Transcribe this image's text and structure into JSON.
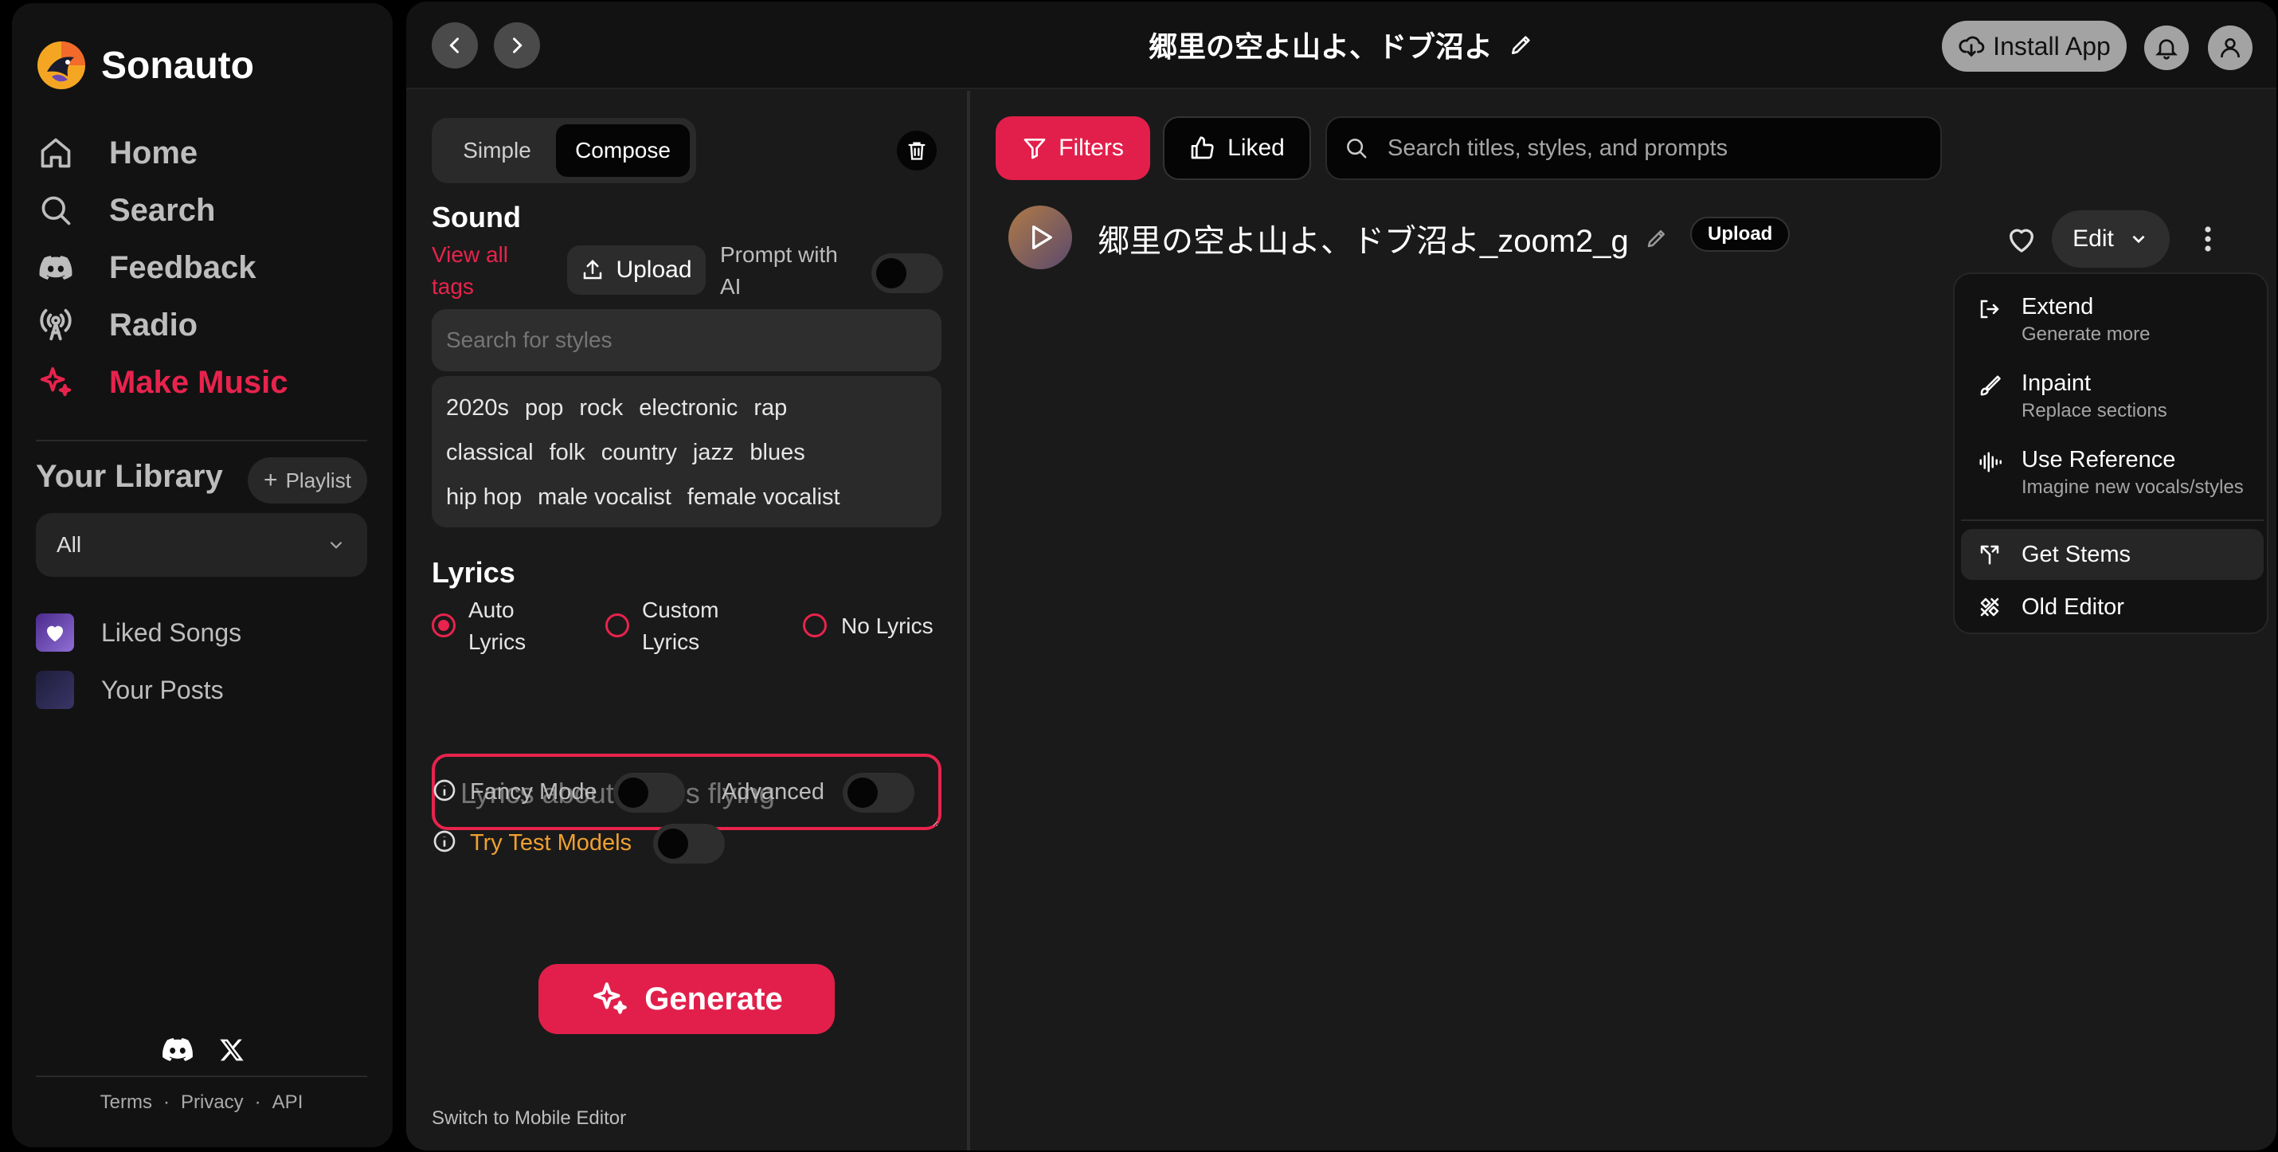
{
  "app": {
    "name": "Sonauto"
  },
  "sidebar": {
    "nav": [
      {
        "label": "Home",
        "icon": "home-icon"
      },
      {
        "label": "Search",
        "icon": "search-icon"
      },
      {
        "label": "Feedback",
        "icon": "discord-icon"
      },
      {
        "label": "Radio",
        "icon": "radio-icon"
      },
      {
        "label": "Make Music",
        "icon": "sparkle-icon",
        "active": true
      }
    ],
    "library_title": "Your Library",
    "playlist_label": "Playlist",
    "filter_value": "All",
    "library_items": [
      {
        "label": "Liked Songs",
        "icon": "heart-icon"
      },
      {
        "label": "Your Posts",
        "icon": "posts-thumb"
      }
    ],
    "footer": {
      "terms": "Terms",
      "privacy": "Privacy",
      "api": "API",
      "separator": "·"
    }
  },
  "topbar": {
    "title": "郷里の空よ山よ、ドブ沼よ",
    "install_label": "Install App"
  },
  "composer": {
    "mode_tabs": [
      "Simple",
      "Compose"
    ],
    "selected_mode": "Compose",
    "sound_heading": "Sound",
    "view_all_tags": "View all tags",
    "upload_label": "Upload",
    "prompt_with_ai": "Prompt with AI",
    "style_search_placeholder": "Search for styles",
    "tags": [
      [
        "2020s",
        "pop",
        "rock",
        "electronic",
        "rap"
      ],
      [
        "classical",
        "folk",
        "country",
        "jazz",
        "blues"
      ],
      [
        "hip hop",
        "male vocalist",
        "female vocalist"
      ]
    ],
    "lyrics_heading": "Lyrics",
    "lyrics_options": [
      "Auto Lyrics",
      "Custom Lyrics",
      "No Lyrics"
    ],
    "lyrics_selected": "Auto Lyrics",
    "lyrics_placeholder": "Lyrics about turtles flying",
    "fancy_mode": "Fancy Mode",
    "advanced": "Advanced",
    "try_test_models": "Try Test Models",
    "generate_label": "Generate",
    "switch_mobile": "Switch to Mobile Editor"
  },
  "library": {
    "filters_label": "Filters",
    "liked_label": "Liked",
    "search_placeholder": "Search titles, styles, and prompts",
    "track": {
      "title": "郷里の空よ山よ、ドブ沼よ_zoom2_g",
      "badge": "Upload",
      "edit_label": "Edit"
    }
  },
  "edit_menu": {
    "items": [
      {
        "title": "Extend",
        "subtitle": "Generate more",
        "icon": "extend-icon"
      },
      {
        "title": "Inpaint",
        "subtitle": "Replace sections",
        "icon": "brush-icon"
      },
      {
        "title": "Use Reference",
        "subtitle": "Imagine new vocals/styles",
        "icon": "waveform-icon"
      },
      {
        "title": "Get Stems",
        "subtitle": "",
        "icon": "split-icon",
        "highlighted": true
      },
      {
        "title": "Old Editor",
        "subtitle": "",
        "icon": "tools-icon"
      }
    ]
  },
  "colors": {
    "accent": "#e21f4b",
    "accent_text": "#e8234d",
    "test_models": "#f0a030",
    "sidebar_bg": "#121212",
    "panel_bg": "#1a1a1a"
  }
}
